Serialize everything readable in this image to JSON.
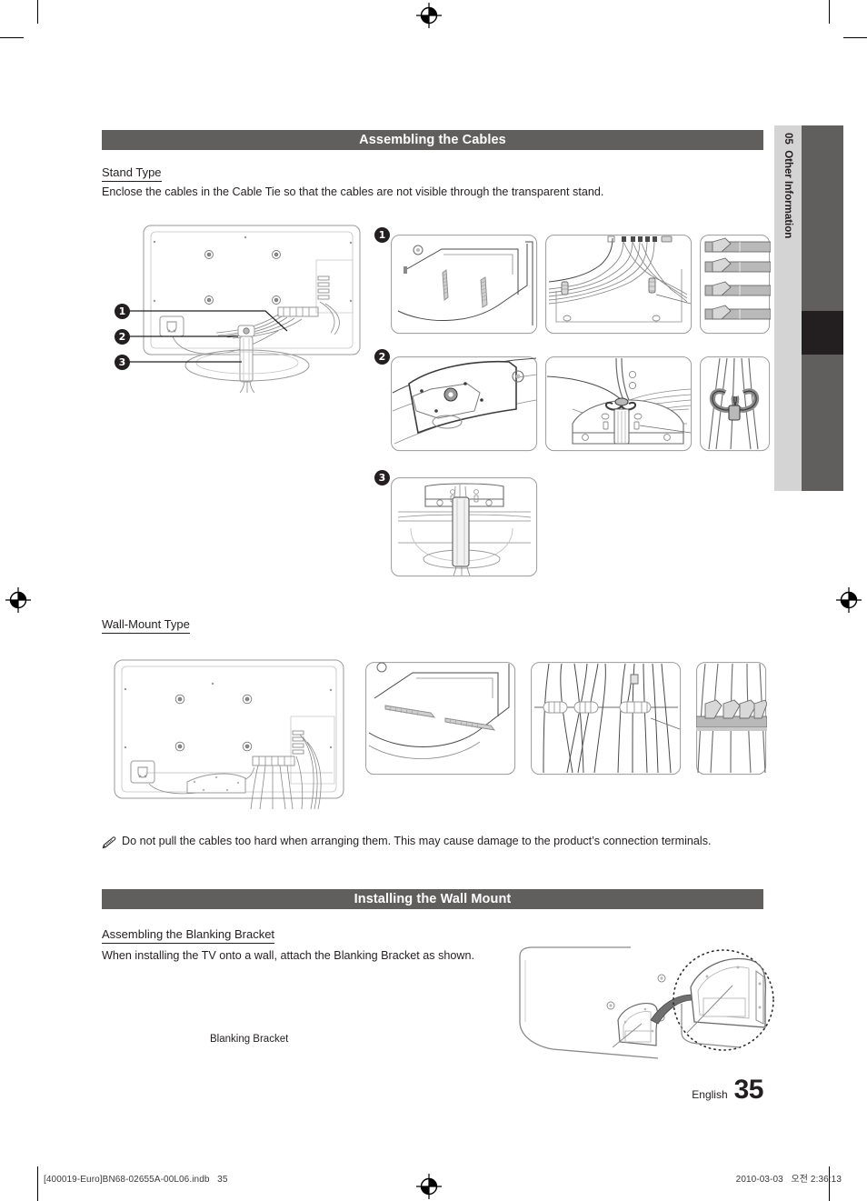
{
  "document": {
    "language": "English",
    "page_number": "35",
    "chapter_number": "05",
    "chapter_title": "Other Information"
  },
  "sections": [
    {
      "id": "assembling-the-cables",
      "bar_title": "Assembling the Cables",
      "subsections": [
        {
          "heading": "Stand Type",
          "body": "Enclose the cables in the Cable Tie so that the cables are not visible through the transparent stand.",
          "callouts": [
            "1",
            "2",
            "3"
          ]
        },
        {
          "heading": "Wall-Mount Type",
          "body": ""
        }
      ],
      "note": {
        "icon": "pencil-note-icon",
        "text": "Do not pull the cables too hard when arranging them. This may cause damage to the product’s connection terminals."
      }
    },
    {
      "id": "installing-the-wall-mount",
      "bar_title": "Installing the Wall Mount",
      "subsections": [
        {
          "heading": "Assembling the Blanking Bracket",
          "body": "When installing the TV onto a wall, attach the Blanking Bracket as shown.",
          "figure_label": "Blanking Bracket"
        }
      ]
    }
  ],
  "figure_callouts": {
    "one": "1",
    "two": "2",
    "three": "3"
  },
  "footer": {
    "imprint_left": "[400019-Euro]BN68-02655A-00L06.indb   35",
    "imprint_right": "2010-03-03   오전 2:36:13"
  },
  "colors": {
    "section_bar": "#615e5e",
    "tab_strip": "#d4d4d4",
    "tab_bar": "#615e5e",
    "tab_bar_active": "#231f20",
    "text": "#231f20"
  }
}
